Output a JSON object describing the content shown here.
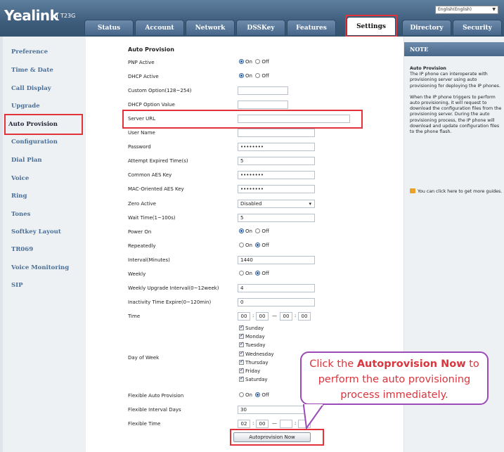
{
  "header": {
    "brand": "Yealink",
    "model": "T23G",
    "language": "English(English)"
  },
  "tabs": [
    "Status",
    "Account",
    "Network",
    "DSSKey",
    "Features",
    "Settings",
    "Directory",
    "Security"
  ],
  "active_tab": "Settings",
  "nav": [
    "Preference",
    "Time & Date",
    "Call Display",
    "Upgrade",
    "Auto Provision",
    "Configuration",
    "Dial Plan",
    "Voice",
    "Ring",
    "Tones",
    "Softkey Layout",
    "TR069",
    "Voice Monitoring",
    "SIP"
  ],
  "active_nav": "Auto Provision",
  "form": {
    "title": "Auto Provision",
    "on": "On",
    "off": "Off",
    "pnp_active": "PNP Active",
    "dhcp_active": "DHCP Active",
    "custom_option": "Custom Option(128~254)",
    "dhcp_option_value": "DHCP Option Value",
    "server_url": "Server URL",
    "user_name": "User Name",
    "password": "Password",
    "password_value": "••••••••",
    "attempt_expired": "Attempt Expired Time(s)",
    "attempt_expired_value": "5",
    "common_aes": "Common AES Key",
    "common_aes_value": "••••••••",
    "mac_aes": "MAC-Oriented AES Key",
    "mac_aes_value": "••••••••",
    "zero_active": "Zero Active",
    "zero_active_value": "Disabled",
    "wait_time": "Wait Time(1~100s)",
    "wait_time_value": "5",
    "power_on": "Power On",
    "repeatedly": "Repeatedly",
    "interval": "Interval(Minutes)",
    "interval_value": "1440",
    "weekly": "Weekly",
    "weekly_upgrade": "Weekly Upgrade Interval(0~12week)",
    "weekly_upgrade_value": "4",
    "inactivity": "Inactivity Time Expire(0~120min)",
    "inactivity_value": "0",
    "time": "Time",
    "time_values": [
      "00",
      "00",
      "00",
      "00"
    ],
    "day_of_week": "Day of Week",
    "days": [
      "Sunday",
      "Monday",
      "Tuesday",
      "Wednesday",
      "Thursday",
      "Friday",
      "Saturday"
    ],
    "flexible_auto": "Flexible Auto Provision",
    "flexible_days": "Flexible Interval Days",
    "flexible_days_value": "30",
    "flexible_time": "Flexible Time",
    "flexible_time_values": [
      "02",
      "00",
      "",
      ""
    ],
    "button": "Autoprovision Now"
  },
  "note": {
    "heading": "NOTE",
    "title": "Auto Provision",
    "text1": "The IP phone can interoperate with provisioning server using auto provisioning for deploying the IP phones.",
    "text2": "When the IP phone triggers to perform auto provisioning, it will request to download the configuration files from the provisioning server. During the auto provisioning process, the IP phone will download and update configuration files to the phone flash.",
    "tip": "You can click here to get more guides."
  },
  "callout": {
    "pre": "Click the ",
    "bold": "Autoprovision Now",
    "post": " to perform the auto provisioning process immediately."
  }
}
